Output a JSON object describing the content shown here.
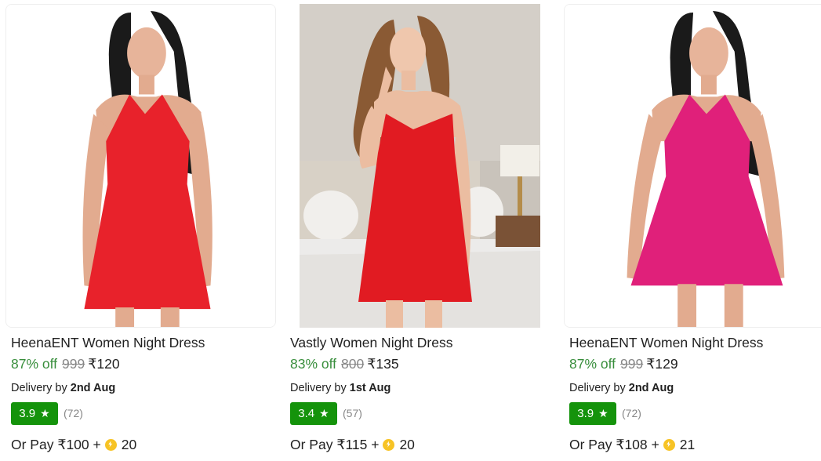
{
  "products": [
    {
      "title": "HeenaENT Women Night Dress",
      "discount": "87% off",
      "mrp": "999",
      "price": "₹120",
      "delivery_prefix": "Delivery by",
      "delivery_date": "2nd Aug",
      "rating": "3.9",
      "rating_count": "(72)",
      "or_pay_text": "Or Pay ₹100 +",
      "coins": "20",
      "dress_color": "#e8222b"
    },
    {
      "title": "Vastly Women Night Dress",
      "discount": "83% off",
      "mrp": "800",
      "price": "₹135",
      "delivery_prefix": "Delivery by",
      "delivery_date": "1st Aug",
      "rating": "3.4",
      "rating_count": "(57)",
      "or_pay_text": "Or Pay ₹115 +",
      "coins": "20",
      "dress_color": "#e11b22"
    },
    {
      "title": "HeenaENT Women Night Dress",
      "discount": "87% off",
      "mrp": "999",
      "price": "₹129",
      "delivery_prefix": "Delivery by",
      "delivery_date": "2nd Aug",
      "rating": "3.9",
      "rating_count": "(72)",
      "or_pay_text": "Or Pay ₹108 +",
      "coins": "21",
      "dress_color": "#e0207a"
    }
  ],
  "colors": {
    "discount": "#388e3c",
    "rating_badge": "#14930b",
    "muted": "#878787",
    "coin": "#f7c325"
  }
}
